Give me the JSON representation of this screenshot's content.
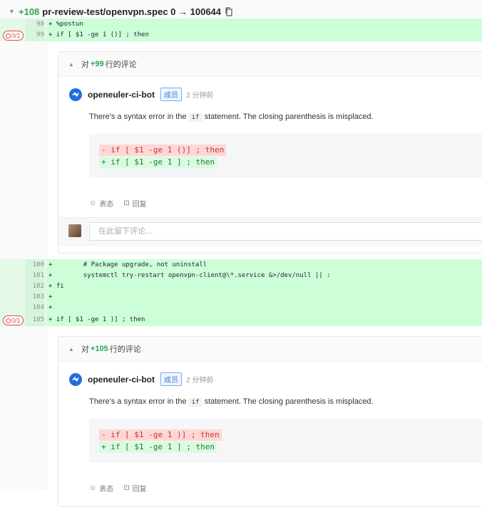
{
  "file": {
    "added": "+108",
    "path": "pr-review-test/openvpn.spec 0 → 100644"
  },
  "badge": "0/1",
  "lines_top": [
    {
      "num": "98",
      "code": "+ %postun"
    },
    {
      "num": "99",
      "code": "+ if [ $1 -ge 1 ()] ; then",
      "badge": true
    }
  ],
  "thread1": {
    "header_prefix": "对",
    "line_ref": "+99",
    "header_suffix": "行的评论",
    "author": "openeuler-ci-bot",
    "role": "成员",
    "time": "2 分钟前",
    "text_before": "There's a syntax error in the",
    "text_code": "if",
    "text_after": "statement. The closing parenthesis is misplaced.",
    "del": "- if [ $1 -ge 1 ()] ; then",
    "ins": "+ if [ $1 -ge 1 ] ; then",
    "react": "表态",
    "reply": "回复",
    "placeholder": "在此留下评论..."
  },
  "lines_mid": [
    {
      "num": "100",
      "code": "+        # Package upgrade, not uninstall"
    },
    {
      "num": "101",
      "code": "+        systemctl try-restart openvpn-client@\\*.service &>/dev/null || :"
    },
    {
      "num": "102",
      "code": "+ fi"
    },
    {
      "num": "103",
      "code": "+"
    },
    {
      "num": "104",
      "code": "+"
    },
    {
      "num": "105",
      "code": "+ if [ $1 -ge 1 )] ; then",
      "badge": true
    }
  ],
  "thread2": {
    "header_prefix": "对",
    "line_ref": "+105",
    "header_suffix": "行的评论",
    "author": "openeuler-ci-bot",
    "role": "成员",
    "time": "2 分钟前",
    "text_before": "There's a syntax error in the",
    "text_code": "if",
    "text_after": "statement. The closing parenthesis is misplaced.",
    "del": "- if [ $1 -ge 1 )] ; then",
    "ins": "+ if [ $1 -ge 1 ] ; then",
    "react": "表态",
    "reply": "回复"
  }
}
